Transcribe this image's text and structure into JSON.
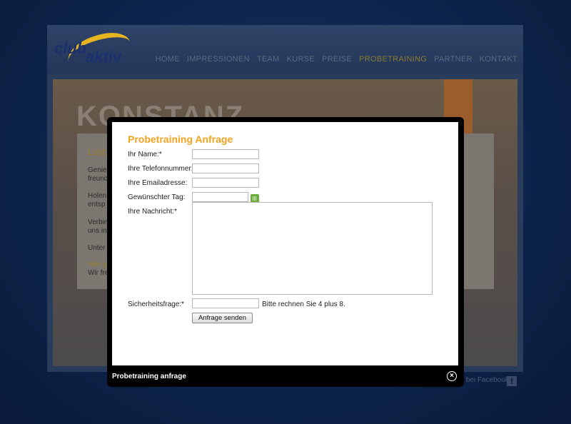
{
  "site": {
    "logo_club": "club",
    "logo_aktiv": "aktiv",
    "nav": [
      "HOME",
      "IMPRESSIONEN",
      "TEAM",
      "KURSE",
      "PREISE",
      "PROBETRAINING",
      "PARTNER",
      "KONTAKT"
    ],
    "active_nav": "PROBETRAINING",
    "hero_title": "KONSTANZ",
    "content_snippets": [
      "Lust",
      "Genie",
      "freund",
      "Holen",
      "entsp",
      "Verbin",
      "uns in",
      "Unter",
      "Hier g",
      "Wir fre"
    ],
    "facebook_text": "tiv bei Facebook",
    "colors": {
      "accent": "#f4a21d",
      "background": "#0f2650"
    }
  },
  "modal": {
    "title": "Probetraining Anfrage",
    "fields": {
      "name_label": "Ihr Name:*",
      "phone_label": "Ihre Telefonnummer:",
      "email_label": "Ihre Emailadresse:",
      "day_label": "Gewünschter Tag:",
      "message_label": "Ihre Nachricht:*",
      "security_label": "Sicherheitsfrage:*",
      "security_hint": "Bitte rechnen Sie 4 plus 8."
    },
    "submit_label": "Anfrage senden",
    "caption": "Probetraining anfrage",
    "calendar_icon": "calendar-icon",
    "close_icon": "close-icon"
  }
}
